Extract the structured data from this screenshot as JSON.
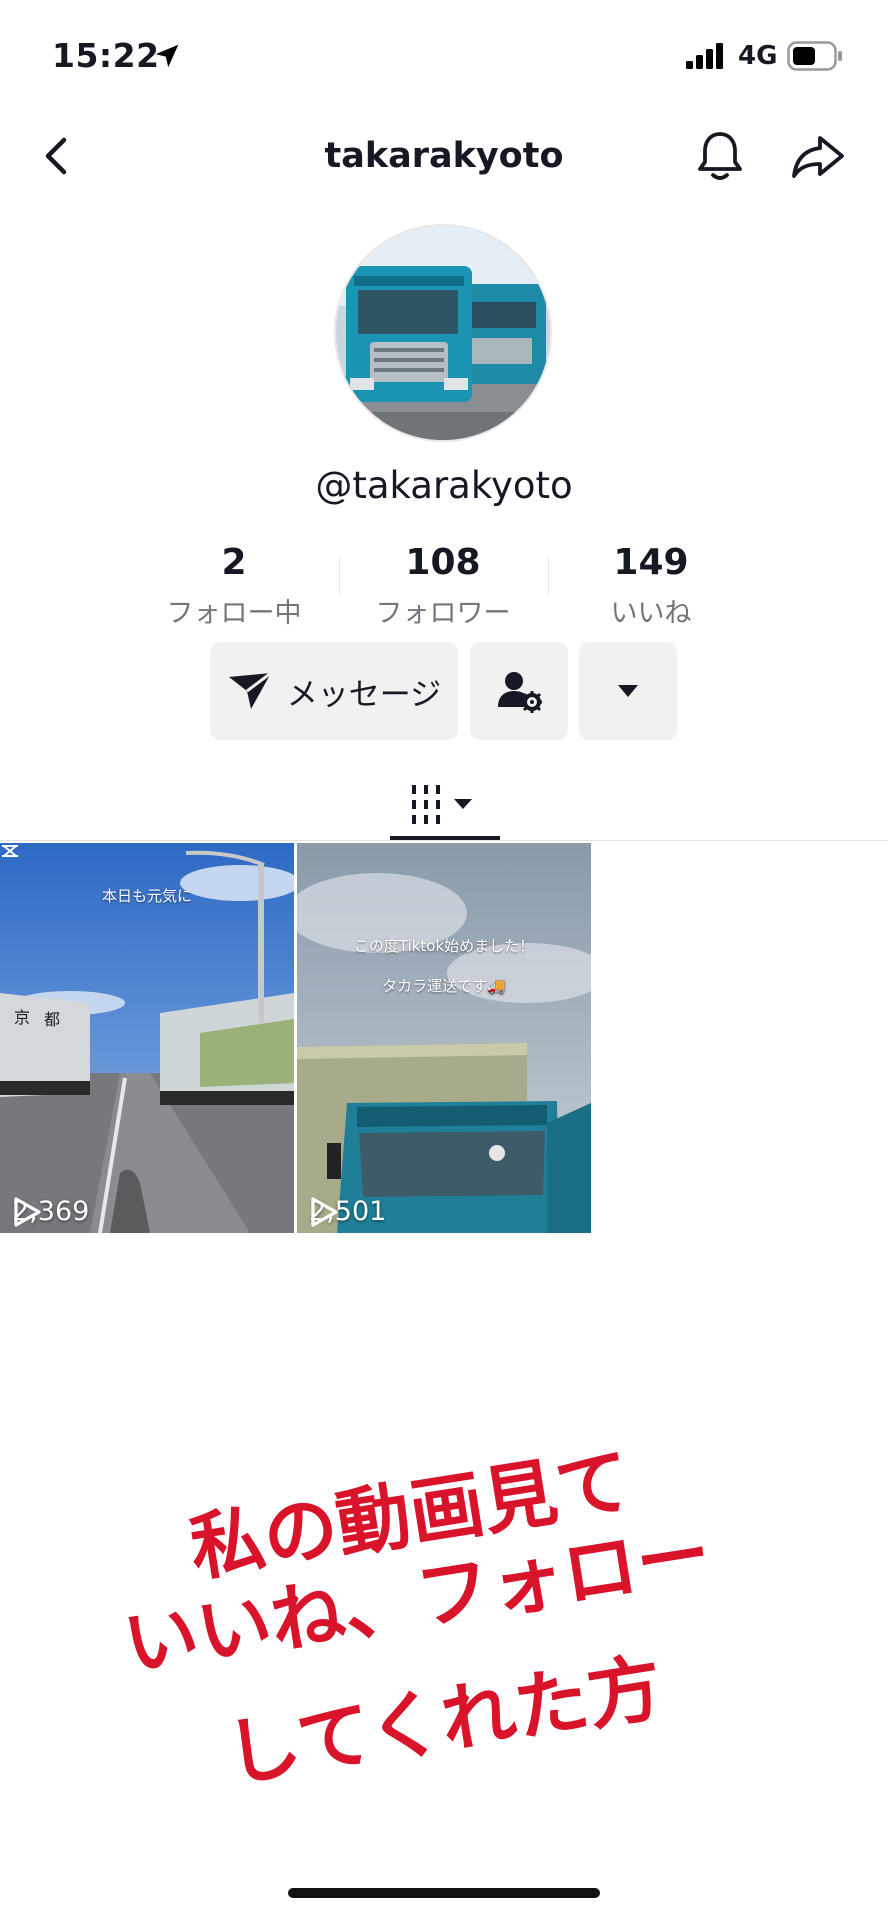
{
  "status_bar": {
    "time": "15:22",
    "network": "4G",
    "icons": [
      "location-arrow-icon",
      "signal-bars-icon",
      "battery-icon"
    ],
    "battery_level": 0.5
  },
  "nav": {
    "title": "takarakyoto",
    "icons": [
      "back-chevron-icon",
      "bell-icon",
      "share-arrow-icon"
    ]
  },
  "profile": {
    "handle": "@takarakyoto",
    "stats": [
      {
        "value": "2",
        "label": "フォロー中"
      },
      {
        "value": "108",
        "label": "フォロワー"
      },
      {
        "value": "149",
        "label": "いいね"
      }
    ]
  },
  "actions": {
    "message_label": "メッセージ",
    "icons": [
      "send-icon",
      "user-settings-icon",
      "caret-down-icon"
    ]
  },
  "tabs": {
    "active_icon": "grid-videos-icon"
  },
  "videos": [
    {
      "caption": "本日も元気に",
      "play_count": "2,369"
    },
    {
      "caption_line1": "この度Tiktok始めました！",
      "caption_line2": "タカラ運送です🚚",
      "play_count": "2,501"
    }
  ],
  "overlay": {
    "line1": "私の動画見て",
    "line2": "いいね、フォロー",
    "line3": "してくれた方"
  },
  "colors": {
    "button_bg": "#f1f1f2",
    "overlay_red": "#d8132a",
    "secondary_text": "#75767c"
  }
}
